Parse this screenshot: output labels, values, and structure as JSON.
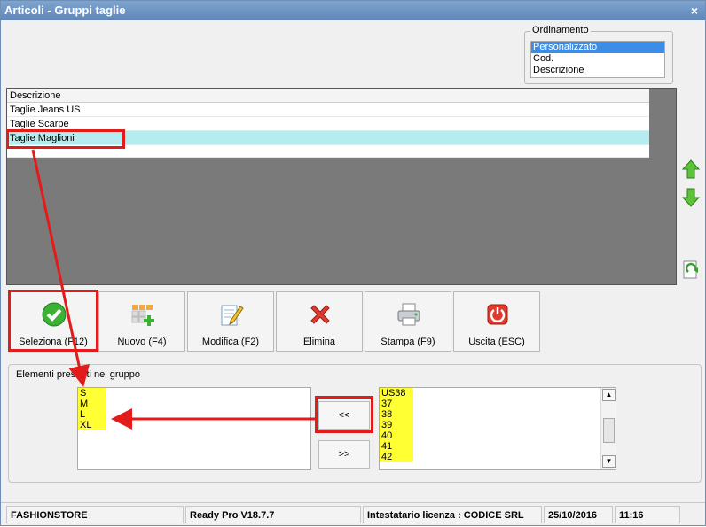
{
  "window": {
    "title": "Articoli - Gruppi taglie",
    "close_label": "×"
  },
  "ordinamento": {
    "title": "Ordinamento",
    "options": [
      "Personalizzato",
      "Cod.",
      "Descrizione"
    ]
  },
  "grid": {
    "header": "Descrizione",
    "rows": [
      "Taglie Jeans US",
      "Taglie Scarpe",
      "Taglie Maglioni"
    ]
  },
  "toolbar": {
    "seleziona": "Seleziona (F12)",
    "nuovo": "Nuovo (F4)",
    "modifica": "Modifica (F2)",
    "elimina": "Elimina",
    "stampa": "Stampa (F9)",
    "uscita": "Uscita (ESC)"
  },
  "group": {
    "title": "Elementi presenti nel gruppo",
    "left_items": [
      "S",
      "M",
      "L",
      "XL"
    ],
    "right_items": [
      "US38",
      "37",
      "38",
      "39",
      "40",
      "41",
      "42"
    ],
    "add_label": "<<",
    "remove_label": ">>"
  },
  "status": {
    "company": "FASHIONSTORE",
    "version": "Ready Pro V18.7.7",
    "license": "Intestatario licenza : CODICE SRL",
    "date": "25/10/2016",
    "time": "11:16"
  },
  "colors": {
    "highlight": "#ffff33",
    "annotation": "#e41b1b",
    "selected_row": "#b4ecef"
  },
  "icons": [
    "green-check-icon",
    "grid-add-icon",
    "edit-pencil-icon",
    "red-x-icon",
    "printer-icon",
    "power-icon",
    "arrow-up-icon",
    "arrow-down-icon",
    "refresh-icon"
  ]
}
